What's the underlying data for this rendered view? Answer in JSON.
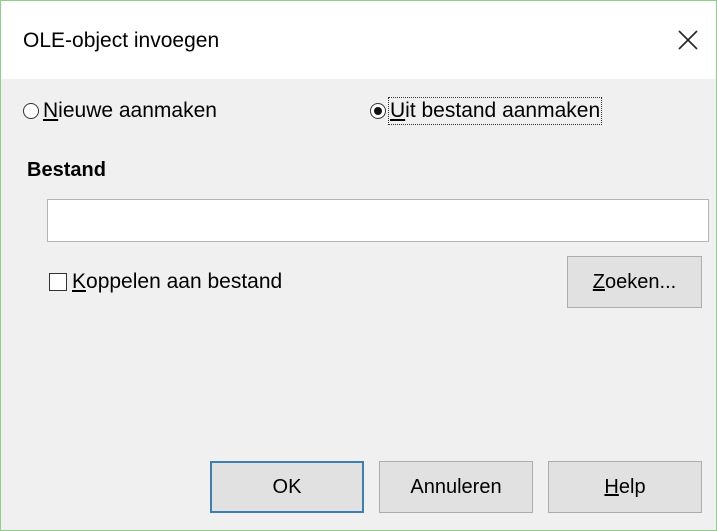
{
  "window": {
    "title": "OLE-object invoegen",
    "close_icon": "close-icon"
  },
  "options": {
    "new_label": "Nieuwe aanmaken",
    "new_selected": false,
    "from_file_label": "Uit bestand aanmaken",
    "from_file_selected": true
  },
  "file_section": {
    "heading": "Bestand",
    "file_value": "",
    "link_label": "Koppelen aan bestand",
    "link_checked": false,
    "search_label": "Zoeken..."
  },
  "buttons": {
    "ok_label": "OK",
    "cancel_label": "Annuleren",
    "help_label": "Help"
  },
  "colors": {
    "window_border": "#8fcf8a",
    "dialog_background": "#f0f0f0",
    "default_button_border": "#3c7fb1"
  }
}
